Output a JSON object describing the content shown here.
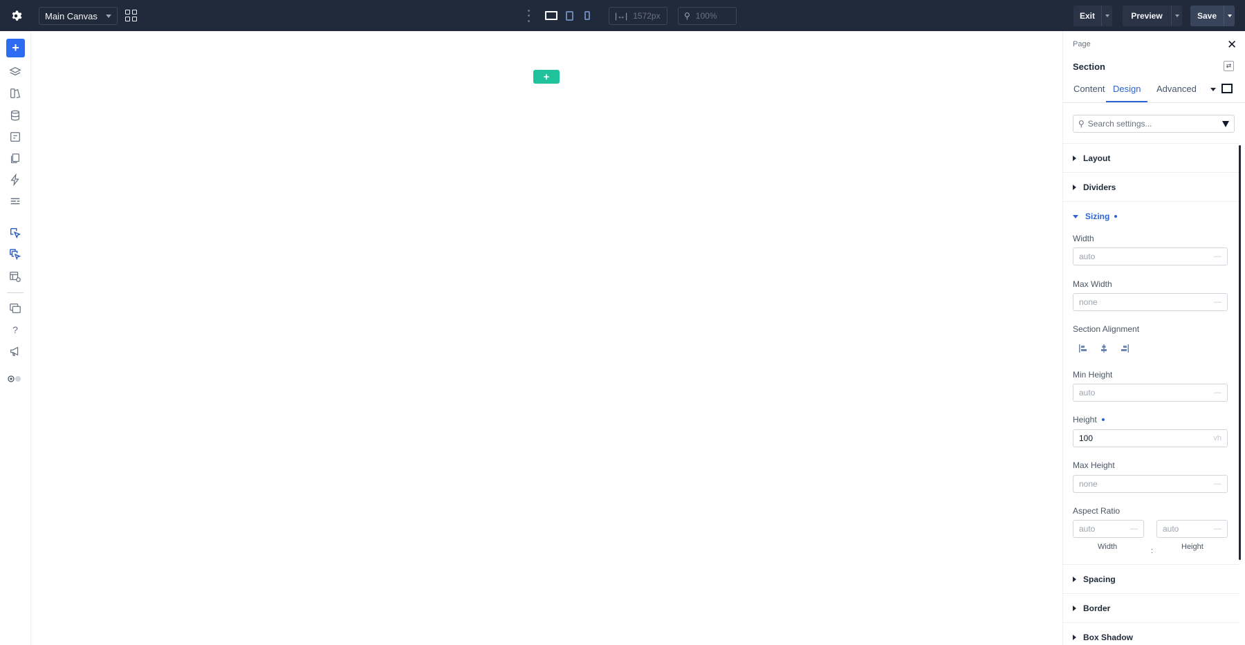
{
  "topbar": {
    "canvas_select": "Main Canvas",
    "width_value": "1572px",
    "zoom_value": "100%",
    "exit_label": "Exit",
    "preview_label": "Preview",
    "save_label": "Save"
  },
  "sidebar": {
    "add_label": "+",
    "help_label": "?"
  },
  "canvas": {
    "add_section_label": "+"
  },
  "panel": {
    "breadcrumb": "Page",
    "title": "Section",
    "tabs": [
      {
        "label": "Content"
      },
      {
        "label": "Design"
      },
      {
        "label": "Advanced"
      }
    ],
    "active_tab": "Design",
    "search_placeholder": "Search settings...",
    "sections": {
      "layout": "Layout",
      "dividers": "Dividers",
      "sizing": "Sizing",
      "spacing": "Spacing",
      "border": "Border",
      "box_shadow": "Box Shadow"
    },
    "sizing": {
      "width": {
        "label": "Width",
        "placeholder": "auto",
        "unit": "—"
      },
      "max_width": {
        "label": "Max Width",
        "placeholder": "none",
        "unit": "—"
      },
      "section_alignment": {
        "label": "Section Alignment"
      },
      "min_height": {
        "label": "Min Height",
        "placeholder": "auto",
        "unit": "—"
      },
      "height": {
        "label": "Height",
        "value": "100",
        "unit": "vh"
      },
      "max_height": {
        "label": "Max Height",
        "placeholder": "none",
        "unit": "—"
      },
      "aspect_ratio": {
        "label": "Aspect Ratio",
        "width_placeholder": "auto",
        "height_placeholder": "auto",
        "unit": "—",
        "width_sub": "Width",
        "height_sub": "Height",
        "separator": ":"
      }
    }
  },
  "colors": {
    "topbar_bg": "#212a3a",
    "accent_blue": "#2b6cf3",
    "add_section_green": "#1fc29a"
  }
}
